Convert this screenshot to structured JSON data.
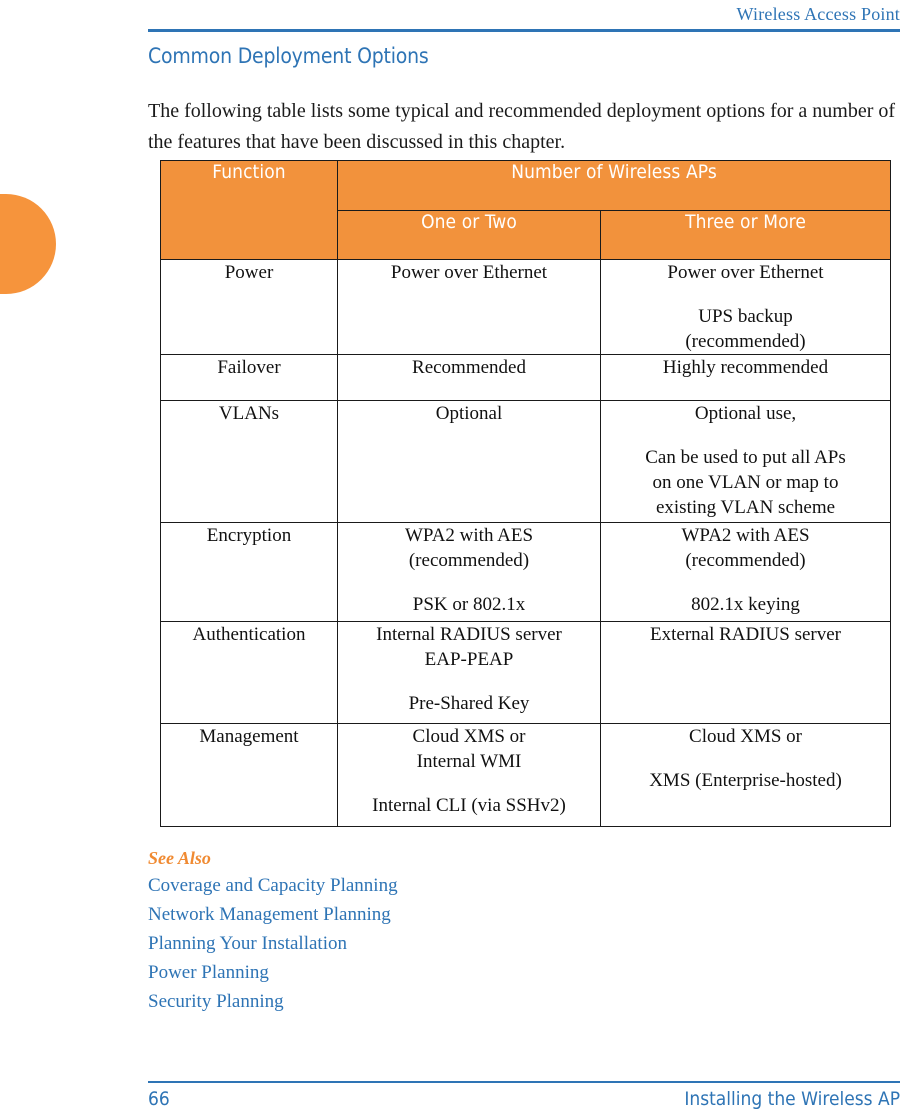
{
  "header": {
    "running_title": "Wireless Access Point"
  },
  "section": {
    "heading": "Common Deployment Options",
    "intro": "The following table lists some typical and recommended deployment options for a number of the features that have been discussed in this chapter."
  },
  "table": {
    "header": {
      "function": "Function",
      "group": "Number of Wireless APs",
      "sub_one": "One or Two",
      "sub_three": "Three or More"
    },
    "rows": [
      {
        "function": "Power",
        "one_or_two": [
          "Power over Ethernet"
        ],
        "three_or_more": [
          "Power over Ethernet",
          "UPS backup",
          "(recommended)"
        ]
      },
      {
        "function": "Failover",
        "one_or_two": [
          "Recommended"
        ],
        "three_or_more": [
          "Highly recommended"
        ]
      },
      {
        "function": "VLANs",
        "one_or_two": [
          "Optional"
        ],
        "three_or_more": [
          "Optional use,",
          "Can be used to put all APs",
          "on one VLAN or map to",
          "existing VLAN scheme"
        ]
      },
      {
        "function": "Encryption",
        "one_or_two": [
          "WPA2 with AES",
          "(recommended)",
          "PSK or 802.1x"
        ],
        "three_or_more": [
          "WPA2 with AES",
          "(recommended)",
          "802.1x keying"
        ]
      },
      {
        "function": "Authentication",
        "one_or_two": [
          "Internal RADIUS server",
          "EAP-PEAP",
          "Pre-Shared Key"
        ],
        "three_or_more": [
          "External RADIUS server"
        ]
      },
      {
        "function": "Management",
        "one_or_two": [
          "Cloud XMS or",
          "Internal WMI",
          "Internal CLI (via SSHv2)"
        ],
        "three_or_more": [
          "Cloud XMS or",
          "XMS (Enterprise-hosted)"
        ]
      }
    ]
  },
  "see_also": {
    "label": "See Also",
    "links": [
      "Coverage and Capacity Planning",
      "Network Management Planning",
      "Planning Your Installation",
      "Power Planning",
      "Security Planning"
    ]
  },
  "footer": {
    "page_number": "66",
    "section_title": "Installing the Wireless AP"
  },
  "colors": {
    "accent_blue": "#2E74B5",
    "accent_orange": "#F2923C",
    "see_also_orange": "#F08A32"
  }
}
